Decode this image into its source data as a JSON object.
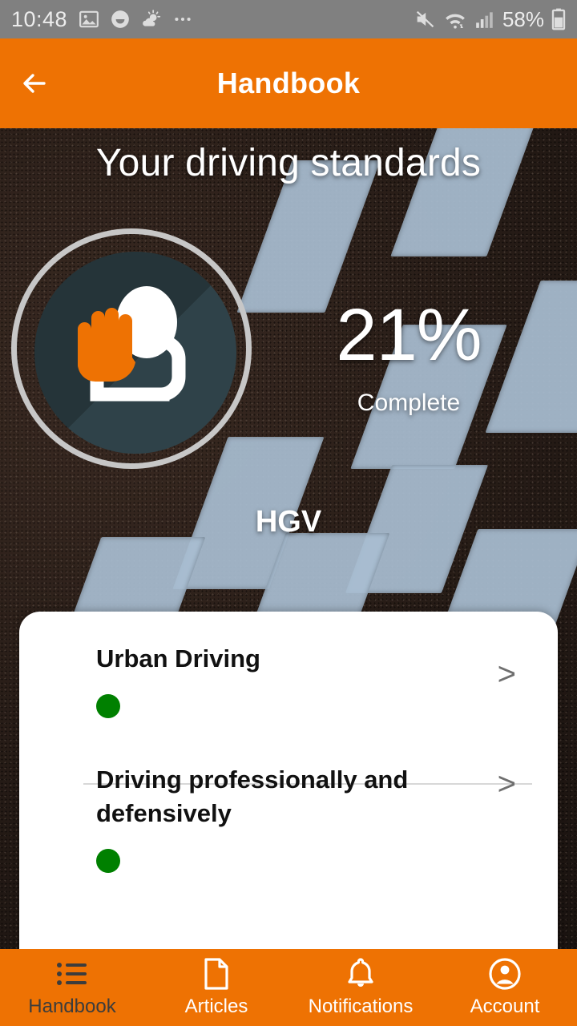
{
  "status_bar": {
    "time": "10:48",
    "battery_text": "58%",
    "left_icons": [
      "image-icon",
      "smiley-icon",
      "weather-icon",
      "more-icon"
    ],
    "right_icons": [
      "mute-icon",
      "wifi-icon",
      "signal-icon",
      "battery-icon"
    ]
  },
  "app_bar": {
    "back_icon": "back-arrow-icon",
    "title": "Handbook",
    "background": "#ee7203"
  },
  "hero": {
    "title": "Your driving standards",
    "badge_icon": "stop-hand-person-icon",
    "percent": "21%",
    "percent_label": "Complete",
    "vehicle_type": "HGV",
    "badge_ring_color": "#c7c7c7",
    "badge_fill_color": "#2f4249",
    "badge_hand_color": "#ee7203"
  },
  "list": {
    "items": [
      {
        "title": "Urban Driving",
        "status_color": "#008000",
        "chevron": ">"
      },
      {
        "title": "Driving professionally and defensively",
        "status_color": "#008000",
        "chevron": ">"
      }
    ]
  },
  "bottom_nav": {
    "items": [
      {
        "label": "Handbook",
        "icon": "list-icon",
        "active": true
      },
      {
        "label": "Articles",
        "icon": "document-icon",
        "active": false
      },
      {
        "label": "Notifications",
        "icon": "bell-icon",
        "active": false
      },
      {
        "label": "Account",
        "icon": "account-circle-icon",
        "active": false
      }
    ],
    "active_color": "#3c3c3c",
    "inactive_color": "#ffffff",
    "background": "#ee7203"
  }
}
